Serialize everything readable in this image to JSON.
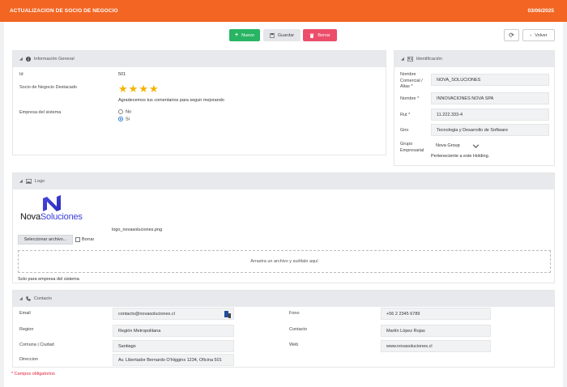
{
  "header": {
    "title": "ACTUALIZACION DE SOCIO DE NEGOCIO",
    "date": "03/06/2025"
  },
  "toolbar": {
    "new_label": "Nuevo",
    "save_label": "Guardar",
    "delete_label": "Borrar",
    "back_label": "Volver"
  },
  "general": {
    "title": "Información General",
    "id_label": "Id",
    "id_value": "501",
    "featured_label": "Socio de Negocio Destacado",
    "rating": 4,
    "rating_text": "Agradecemos tus comentarios para seguir mejorando",
    "system_label": "Empresa del sistema",
    "options": [
      "No",
      "Si"
    ],
    "selected": "Si"
  },
  "identification": {
    "title": "Identificación",
    "name_label": "Nombre Comercial / Alias *",
    "name_value": "NOVA_SOLUCIONES",
    "legal_label": "Nombre *",
    "legal_value": "INNOVACIONES NOVA SPA",
    "rut_label": "Rut *",
    "rut_value": "11.222.333-4",
    "giro_label": "Giro",
    "giro_value": "Tecnologia y Desarrollo de Software",
    "group_label": "Grupo Empresarial",
    "group_value": "Nova Group",
    "group_note": "Perteneciente a este Holding."
  },
  "logo": {
    "title": "Logo",
    "brand_left": "Nova",
    "brand_right": "Soluciones",
    "file_name": "logo_novasoluciones.png",
    "select_label": "Seleccionar archivo...",
    "delete_label": "Borrar",
    "drop_text": "Arrastra un archivo y suéltalo aquí",
    "note": "Solo para empresa del sistema"
  },
  "contact": {
    "title": "Contacto",
    "email_label": "Email",
    "email_value": "contacto@novasoluciones.cl",
    "region_label": "Region",
    "region_value": "Región Metropolitana",
    "comuna_label": "Comuna | Ciudad",
    "comuna_value": "Santiago",
    "address_label": "Direccion",
    "address_value": "Av. Libertador Bernardo O'Higgins 1234, Oficina 501",
    "phone_label": "Fono",
    "phone_value": "+56 2 2345 6789",
    "contact_label": "Contacto",
    "contact_value": "Martín López Rojas",
    "web_label": "Web",
    "web_value": "www.novasoluciones.cl"
  },
  "footer": {
    "required_note": "* Campos obligatorios"
  },
  "colors": {
    "accent": "#f26522",
    "green": "#28b463",
    "red": "#eb4d6b",
    "star": "#f5b301",
    "brand_blue": "#3b3fd8"
  }
}
